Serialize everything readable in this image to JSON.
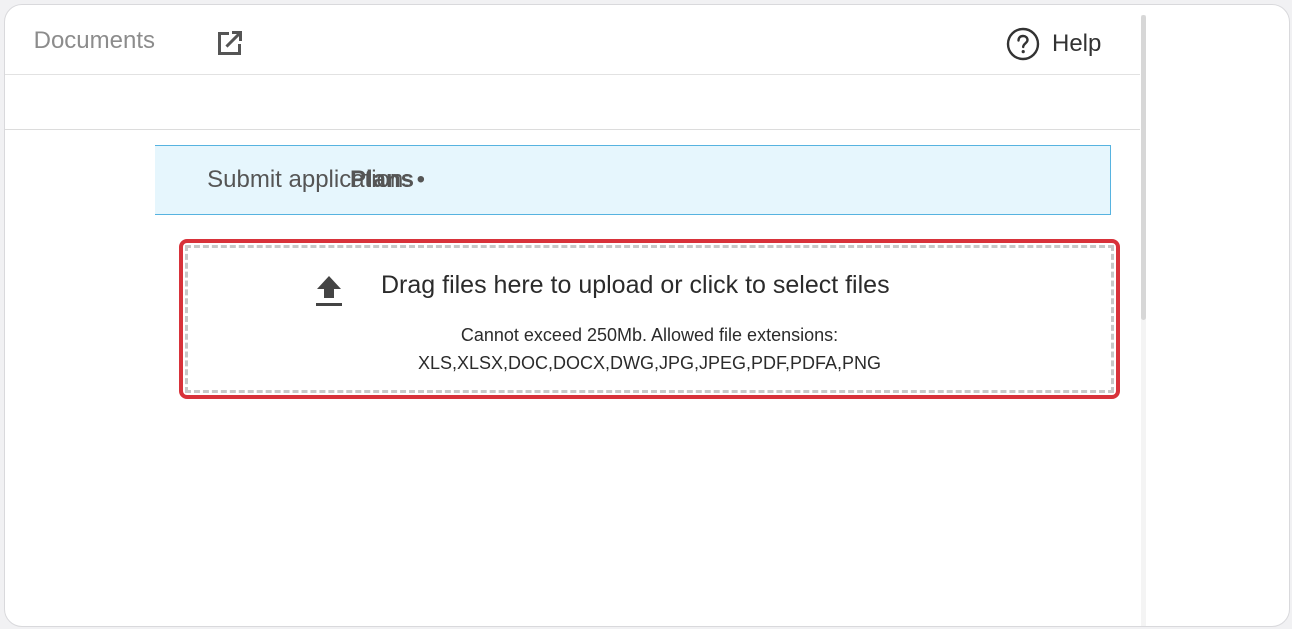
{
  "header": {
    "documents_link": "Documents",
    "help_label": "Help"
  },
  "banner": {
    "text": "Submit application: •",
    "bold": "Plans"
  },
  "upload": {
    "title": "Drag files here to upload or click to select files",
    "limit_text": "Cannot exceed 250Mb. Allowed file extensions:",
    "extensions": "XLS,XLSX,DOC,DOCX,DWG,JPG,JPEG,PDF,PDFA,PNG"
  },
  "colors": {
    "highlight": "#d8323a",
    "banner_bg": "#e6f6fd",
    "banner_border": "#57b3e0"
  },
  "icons": [
    "external-link-icon",
    "help-circle-icon",
    "upload-icon"
  ]
}
